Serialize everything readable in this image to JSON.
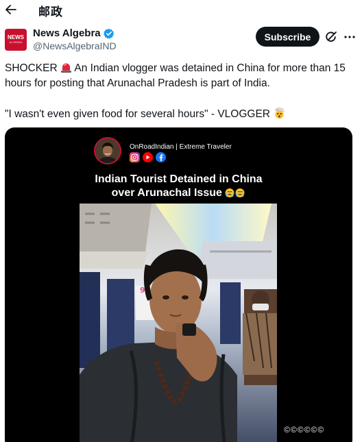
{
  "header": {
    "title": "邮政",
    "back_icon": "arrow-left-icon"
  },
  "author": {
    "name": "News Algebra",
    "handle": "@NewsAlgebraIND",
    "verified": true,
    "verified_color": "#1d9bf0",
    "logo_text_line1": "NEWS",
    "logo_text_line2": "ALGEBRA"
  },
  "actions": {
    "subscribe_label": "Subscribe",
    "grok_icon": "grok-icon",
    "more_icon": "more-icon"
  },
  "tweet": {
    "line1_a": "SHOCKER",
    "line1_b": "An Indian vlogger was detained in China for more than 15 hours for posting that Arunachal Pradesh is part of India.",
    "line2": "\"I wasn't even given food for several hours\" - VLOGGER",
    "emoji_1": "police-light-emoji",
    "emoji_2": "exploding-head-emoji"
  },
  "media": {
    "channel_name": "OnRoadIndian | Extreme Traveler",
    "social_icons": [
      "instagram-icon",
      "youtube-icon",
      "facebook-icon"
    ],
    "title_line1": "Indian Tourist Detained in China",
    "title_line2": "over Arunachal Issue",
    "title_emoji": "crying-face-emoji",
    "watermark": "©©©©©©"
  }
}
